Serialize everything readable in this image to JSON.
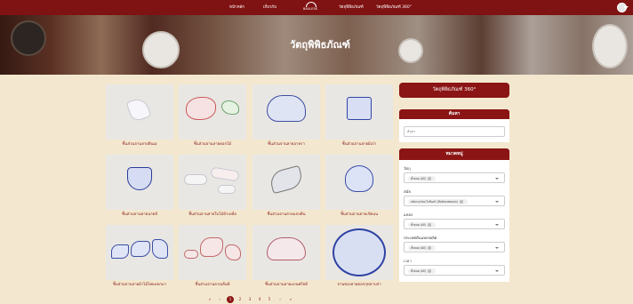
{
  "nav": {
    "links": [
      "หน้าหลัก",
      "เกี่ยวกับ",
      "วัตถุพิพิธภัณฑ์",
      "วัตถุพิพิธภัณฑ์ 360°"
    ],
    "logo_text": "BAULESK"
  },
  "banner": {
    "title": "วัตถุพิพิธภัณฑ์"
  },
  "items": [
    {
      "caption": "ชิ้นส่วนจานลายดินเผ"
    },
    {
      "caption": "ชิ้นส่วนจานลายดอกไม้"
    },
    {
      "caption": "ชิ้นส่วนจานลายอาหรา"
    },
    {
      "caption": "ชิ้นส่วนจานลายผีเป่า"
    },
    {
      "caption": "ชิ้นส่วนจานลายนาคลี"
    },
    {
      "caption": "ชิ้นส่วนจานลายใบไม้ห้าเหลี่ย"
    },
    {
      "caption": "ชิ้นส่วนจานลายแถบดิน"
    },
    {
      "caption": "ชิ้นส่วนจานลายเขียนน"
    },
    {
      "caption": "ชิ้นส่วนจานลายผ้าไม้ไทยแขกมา"
    },
    {
      "caption": "ชิ้นส่วนจานลายเส้นดี"
    },
    {
      "caption": "ชิ้นส่วนจานลายแกนศรีอดี"
    },
    {
      "caption": "จานของลายดอกกุหลาบป่า"
    }
  ],
  "sidebar": {
    "button_360": "วัตถุพิพิธภัณฑ์ 360°",
    "search_title": "ค้นหา",
    "search_placeholder": "ค้นหา",
    "category_title": "หมวดหมู่",
    "filters": [
      {
        "label": "วัตถุ",
        "value": "ทั้งหมด (All)"
      },
      {
        "label": "สมัย",
        "value": "สมัยกรุงรัตนโกสินทร์ (Rattanakosin)"
      },
      {
        "label": "แหล่ง",
        "value": "ทั้งหมด (All)"
      },
      {
        "label": "ประเทศต้นแหล่งผลิต",
        "value": "ทั้งหมด (All)"
      },
      {
        "label": "เวลา",
        "value": "ทั้งหมด (All)"
      }
    ]
  },
  "pagination": {
    "prev_first": "«",
    "prev": "‹",
    "pages": [
      "1",
      "2",
      "3",
      "4",
      "5"
    ],
    "next": "›",
    "next_last": "»",
    "active": "1"
  },
  "colors": {
    "primary": "#8b1414",
    "background": "#f3e8cf",
    "nav": "#7f1212"
  }
}
